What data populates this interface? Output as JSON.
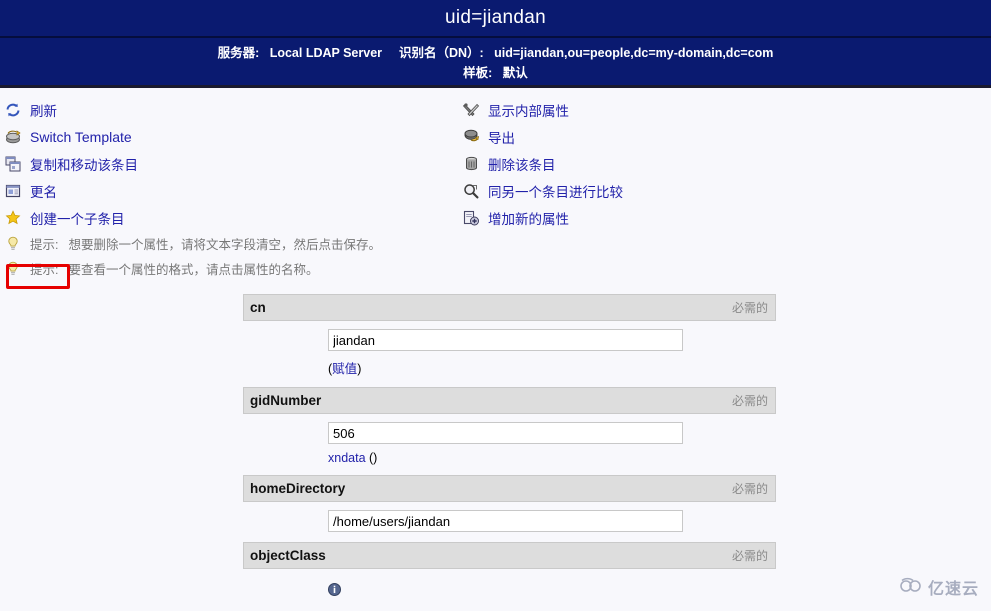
{
  "header": {
    "title": "uid=jiandan",
    "server_label": "服务器:",
    "server_name": "Local LDAP Server",
    "dn_label": "识别名（DN）:",
    "dn_value": "uid=jiandan,ou=people,dc=my-domain,dc=com",
    "template_label": "样板:",
    "template_value": "默认",
    "bg_color": "#0a1a70",
    "text_color": "#ffffff"
  },
  "actions": {
    "left": [
      {
        "label": "刷新",
        "icon": "refresh-icon",
        "lang": "zh"
      },
      {
        "label": "Switch Template",
        "icon": "switch-template-icon",
        "lang": "en"
      },
      {
        "label": "复制和移动该条目",
        "icon": "copy-move-icon",
        "lang": "zh"
      },
      {
        "label": "更名",
        "icon": "rename-icon",
        "lang": "zh"
      },
      {
        "label": "创建一个子条目",
        "icon": "star-icon",
        "lang": "zh"
      }
    ],
    "right": [
      {
        "label": "显示内部属性",
        "icon": "tools-icon"
      },
      {
        "label": "导出",
        "icon": "export-icon"
      },
      {
        "label": "删除该条目",
        "icon": "trash-icon"
      },
      {
        "label": "同另一个条目进行比较",
        "icon": "compare-search-icon"
      },
      {
        "label": "增加新的属性",
        "icon": "add-attribute-icon"
      }
    ],
    "highlight": {
      "target": "更名",
      "color": "#e60000"
    }
  },
  "hints": [
    {
      "key": "提示:",
      "text": "想要删除一个属性，请将文本字段清空，然后点击保存。"
    },
    {
      "key": "提示:",
      "text": "要查看一个属性的格式，请点击属性的名称。"
    }
  ],
  "attributes": [
    {
      "name": "cn",
      "required_label": "必需的",
      "value": "jiandan",
      "sub_prefix": "(",
      "sub_link": "赋值",
      "sub_suffix": ")"
    },
    {
      "name": "gidNumber",
      "required_label": "必需的",
      "value": "506",
      "sub_prefix": "",
      "sub_link": "xndata",
      "sub_suffix": " ()"
    },
    {
      "name": "homeDirectory",
      "required_label": "必需的",
      "value": "/home/users/jiandan",
      "sub_prefix": "",
      "sub_link": "",
      "sub_suffix": ""
    },
    {
      "name": "objectClass",
      "required_label": "必需的",
      "value": "",
      "sub_prefix": "",
      "sub_link": "",
      "sub_suffix": ""
    }
  ],
  "watermark": {
    "text": "亿速云",
    "icon": "cloud-logo-icon",
    "color": "#9aa0b5"
  }
}
